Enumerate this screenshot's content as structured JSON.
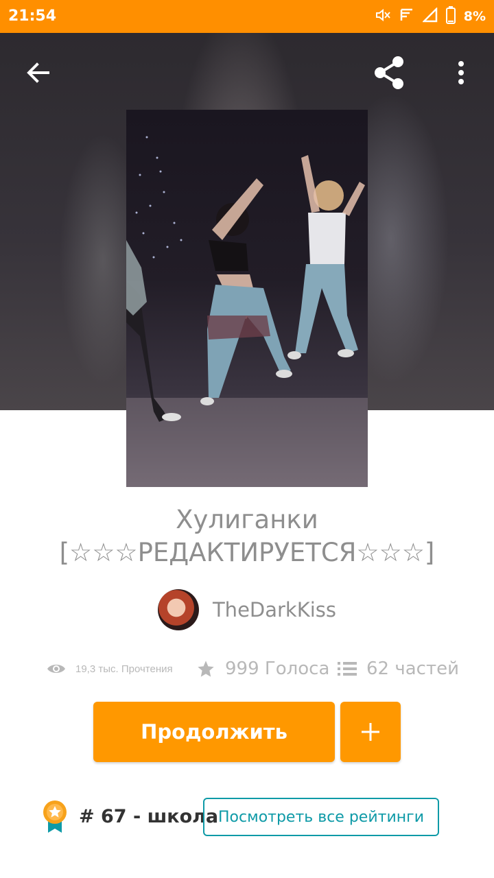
{
  "status_bar": {
    "time": "21:54",
    "battery": "8%",
    "icons": [
      "mute-icon",
      "signal-icon",
      "cell-signal-icon",
      "battery-icon"
    ]
  },
  "toolbar": {
    "icons": [
      "back-arrow-icon",
      "share-icon",
      "more-vert-icon"
    ]
  },
  "story": {
    "title": "Хулиганки [☆☆☆РЕДАКТИРУЕТСЯ☆☆☆]",
    "author": "TheDarkKiss"
  },
  "stats": {
    "reads": "19,3 тыс. Прочтения",
    "votes": "999 Голоса",
    "parts": "62 частей"
  },
  "actions": {
    "continue_label": "Продолжить",
    "add_label": "+"
  },
  "ranking": {
    "text": "# 67 - школа",
    "view_all_label": "Посмотреть все рейтинги"
  },
  "colors": {
    "accent": "#ff9800",
    "status_bar": "#ff8f00",
    "link": "#0e9aa7",
    "muted_text": "#8e8e8e"
  }
}
